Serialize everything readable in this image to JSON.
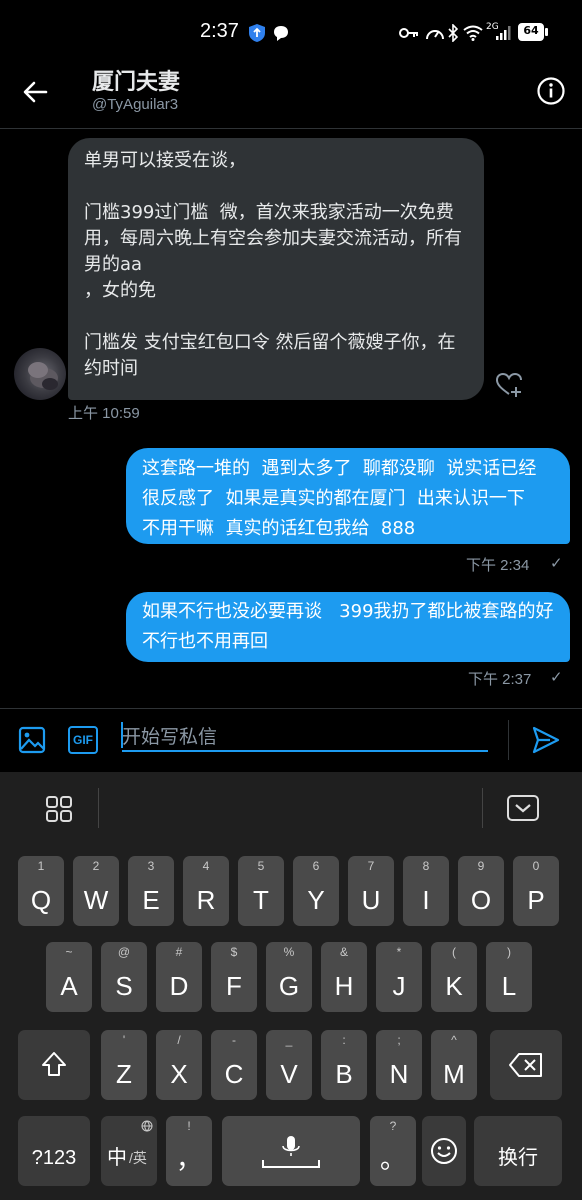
{
  "status_bar": {
    "time": "2:37",
    "network": "2G",
    "battery": "64"
  },
  "header": {
    "title": "厦门夫妻",
    "handle": "@TyAguilar3"
  },
  "messages": [
    {
      "direction": "incoming",
      "text": "单男可以接受在谈，\n\n门槛399过门槛  微，首次来我家活动一次免费用，每周六晚上有空会参加夫妻交流活动，所有男的aa\n，女的免\n\n门槛发 支付宝红包口令 然后留个薇嫂子你，在约时间",
      "timestamp": "上午 10:59"
    },
    {
      "direction": "outgoing",
      "text": "这套路一堆的  遇到太多了  聊都没聊  说实话已经很反感了  如果是真实的都在厦门  出来认识一下  不用干嘛  真实的话红包我给  888",
      "timestamp": "下午 2:34",
      "status": "✓"
    },
    {
      "direction": "outgoing",
      "text": "如果不行也没必要再谈   399我扔了都比被套路的好  不行也不用再回",
      "timestamp": "下午 2:37",
      "status": "✓"
    }
  ],
  "compose": {
    "placeholder": "开始写私信",
    "gif_label": "GIF"
  },
  "keyboard": {
    "row1": [
      {
        "main": "Q",
        "sub": "1"
      },
      {
        "main": "W",
        "sub": "2"
      },
      {
        "main": "E",
        "sub": "3"
      },
      {
        "main": "R",
        "sub": "4"
      },
      {
        "main": "T",
        "sub": "5"
      },
      {
        "main": "Y",
        "sub": "6"
      },
      {
        "main": "U",
        "sub": "7"
      },
      {
        "main": "I",
        "sub": "8"
      },
      {
        "main": "O",
        "sub": "9"
      },
      {
        "main": "P",
        "sub": "0"
      }
    ],
    "row2": [
      {
        "main": "A",
        "sub": "~"
      },
      {
        "main": "S",
        "sub": "@"
      },
      {
        "main": "D",
        "sub": "#"
      },
      {
        "main": "F",
        "sub": "$"
      },
      {
        "main": "G",
        "sub": "%"
      },
      {
        "main": "H",
        "sub": "&"
      },
      {
        "main": "J",
        "sub": "*"
      },
      {
        "main": "K",
        "sub": "("
      },
      {
        "main": "L",
        "sub": ")"
      }
    ],
    "row3": [
      {
        "main": "Z",
        "sub": "'"
      },
      {
        "main": "X",
        "sub": "/"
      },
      {
        "main": "C",
        "sub": "-"
      },
      {
        "main": "V",
        "sub": "_"
      },
      {
        "main": "B",
        "sub": ":"
      },
      {
        "main": "N",
        "sub": ";"
      },
      {
        "main": "M",
        "sub": "^"
      }
    ],
    "row4": {
      "num_label": "?123",
      "lang_label": "中",
      "lang_sub": "/英",
      "comma": "，",
      "comma_sub": "!",
      "period": "。",
      "period_sub": "?",
      "enter_label": "换行"
    }
  }
}
